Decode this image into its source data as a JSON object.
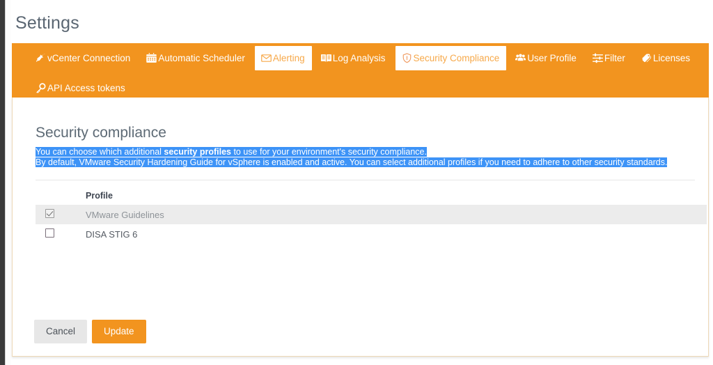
{
  "page": {
    "title": "Settings",
    "accent_color": "#f2941f",
    "highlight_color": "#3d93f7"
  },
  "tabs": {
    "row1": [
      {
        "label": "vCenter Connection",
        "icon": "plug-icon",
        "active": false
      },
      {
        "label": "Automatic Scheduler",
        "icon": "calendar-icon",
        "active": false
      },
      {
        "label": "Alerting",
        "icon": "envelope-icon",
        "active": true
      },
      {
        "label": "Log Analysis",
        "icon": "book-icon",
        "active": false
      },
      {
        "label": "Security Compliance",
        "icon": "shield-icon",
        "active": true
      },
      {
        "label": "User Profile",
        "icon": "users-icon",
        "active": false
      },
      {
        "label": "Filter",
        "icon": "sliders-icon",
        "active": false
      },
      {
        "label": "Licenses",
        "icon": "tags-icon",
        "active": false
      }
    ],
    "row2": [
      {
        "label": "API Access tokens",
        "icon": "key-icon",
        "active": false
      }
    ]
  },
  "content": {
    "heading": "Security compliance",
    "description_line1_a": "You can choose which additional ",
    "description_line1_b": "security profiles",
    "description_line1_c": " to use for your environment's security compliance.",
    "description_line2": "By default, VMware Security Hardening Guide for vSphere is enabled and active. You can select additional profiles if you need to adhere to other security standards."
  },
  "table": {
    "columns": [
      "",
      "Profile"
    ],
    "rows": [
      {
        "profile": "VMware Guidelines",
        "checked": true,
        "selected": true
      },
      {
        "profile": "DISA STIG 6",
        "checked": false,
        "selected": false
      }
    ]
  },
  "footer": {
    "cancel_label": "Cancel",
    "update_label": "Update"
  }
}
